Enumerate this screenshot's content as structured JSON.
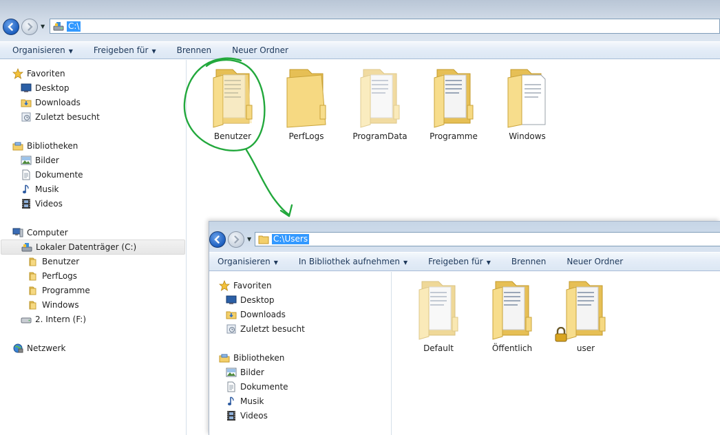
{
  "window_main": {
    "address": {
      "path": "C:\\"
    },
    "toolbar": [
      {
        "label": "Organisieren",
        "dropdown": true
      },
      {
        "label": "Freigeben für",
        "dropdown": true
      },
      {
        "label": "Brennen",
        "dropdown": false
      },
      {
        "label": "Neuer Ordner",
        "dropdown": false
      }
    ],
    "nav": {
      "favorites": {
        "label": "Favoriten",
        "items": [
          "Desktop",
          "Downloads",
          "Zuletzt besucht"
        ]
      },
      "libraries": {
        "label": "Bibliotheken",
        "items": [
          "Bilder",
          "Dokumente",
          "Musik",
          "Videos"
        ]
      },
      "computer": {
        "label": "Computer",
        "drive_c": "Lokaler Datenträger (C:)",
        "drive_c_children": [
          "Benutzer",
          "PerfLogs",
          "Programme",
          "Windows"
        ],
        "drive_f": "2. Intern (F:)"
      },
      "network": {
        "label": "Netzwerk"
      }
    },
    "folders": [
      "Benutzer",
      "PerfLogs",
      "ProgramData",
      "Programme",
      "Windows"
    ]
  },
  "window_inset": {
    "address": {
      "path": "C:\\Users"
    },
    "toolbar": [
      {
        "label": "Organisieren",
        "dropdown": true
      },
      {
        "label": "In Bibliothek aufnehmen",
        "dropdown": true
      },
      {
        "label": "Freigeben für",
        "dropdown": true
      },
      {
        "label": "Brennen",
        "dropdown": false
      },
      {
        "label": "Neuer Ordner",
        "dropdown": false
      }
    ],
    "nav": {
      "favorites": {
        "label": "Favoriten",
        "items": [
          "Desktop",
          "Downloads",
          "Zuletzt besucht"
        ]
      },
      "libraries": {
        "label": "Bibliotheken",
        "items": [
          "Bilder",
          "Dokumente",
          "Musik",
          "Videos"
        ]
      }
    },
    "folders": [
      "Default",
      "Öffentlich",
      "user"
    ]
  },
  "colors": {
    "accent_selection": "#3399ff",
    "annotation": "#22a83c",
    "folder": "#f6d982"
  }
}
